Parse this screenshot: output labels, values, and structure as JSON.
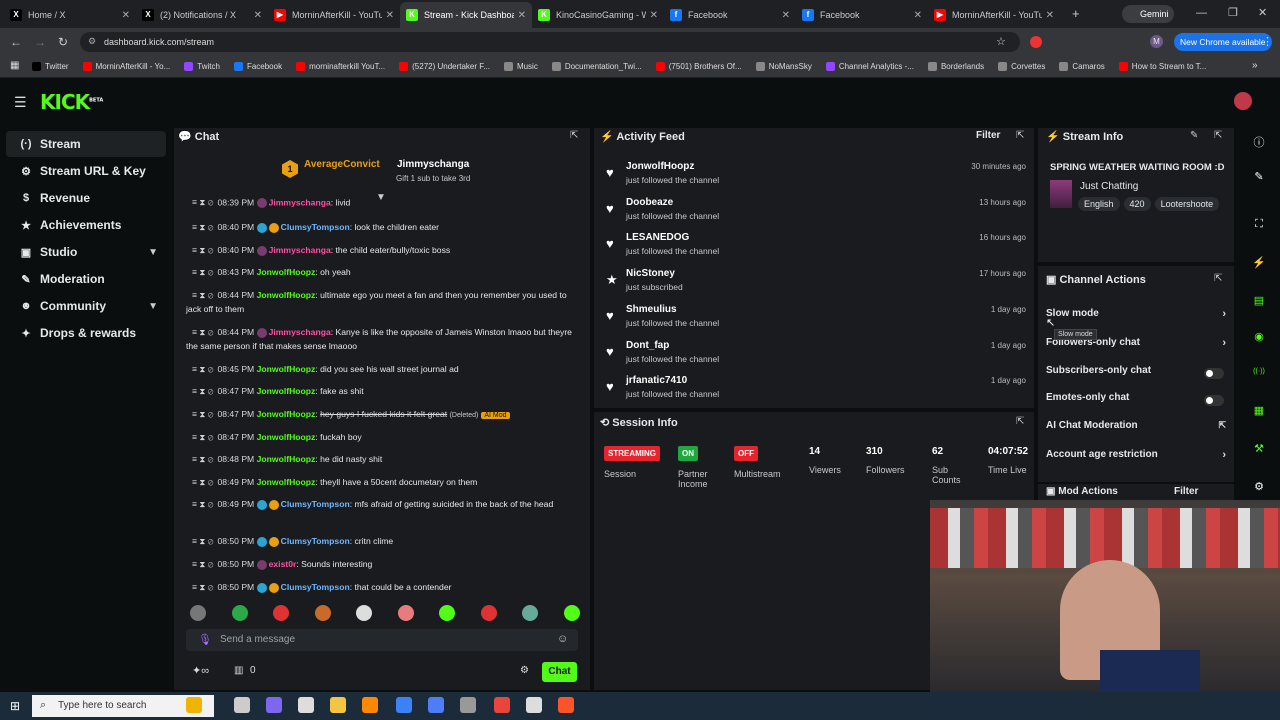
{
  "browser": {
    "tabs": [
      {
        "title": "Home / X",
        "color": "#000000",
        "glyph": "X"
      },
      {
        "title": "(2) Notifications / X",
        "color": "#000000",
        "glyph": "X"
      },
      {
        "title": "MorninAfterKill - YouTu",
        "color": "#ff0000",
        "glyph": "▶"
      },
      {
        "title": "Stream - Kick Dashboa",
        "color": "#53fc18",
        "glyph": "K"
      },
      {
        "title": "KinoCasinoGaming - W",
        "color": "#53fc18",
        "glyph": "K"
      },
      {
        "title": "Facebook",
        "color": "#1877f2",
        "glyph": "f"
      },
      {
        "title": "Facebook",
        "color": "#1877f2",
        "glyph": "f"
      },
      {
        "title": "MorninAfterKill - YouTu",
        "color": "#ff0000",
        "glyph": "▶"
      }
    ],
    "gemini_label": "Gemini",
    "url": "dashboard.kick.com/stream",
    "new_chrome": "New Chrome available",
    "bookmarks": [
      {
        "label": "Twitter",
        "color": "#000000"
      },
      {
        "label": "MorninAfterKill - Yo...",
        "color": "#ff0000"
      },
      {
        "label": "Twitch",
        "color": "#9146ff"
      },
      {
        "label": "Facebook",
        "color": "#1877f2"
      },
      {
        "label": "morninafterkill YouT...",
        "color": "#ff0000"
      },
      {
        "label": "(5272) Undertaker F...",
        "color": "#ff0000"
      },
      {
        "label": "Music",
        "color": "#888888"
      },
      {
        "label": "Documentation_Twi...",
        "color": "#888888"
      },
      {
        "label": "(7501) Brothers Of...",
        "color": "#ff0000"
      },
      {
        "label": "NoMansSky",
        "color": "#888888"
      },
      {
        "label": "Channel Analytics -...",
        "color": "#9146ff"
      },
      {
        "label": "Borderlands",
        "color": "#888888"
      },
      {
        "label": "Corvettes",
        "color": "#888888"
      },
      {
        "label": "Camaros",
        "color": "#888888"
      },
      {
        "label": "How to Stream to T...",
        "color": "#ff0000"
      }
    ]
  },
  "kick": {
    "logo": "KICK",
    "beta": "BETA",
    "accent": "#53fc18"
  },
  "sidebar": {
    "items": [
      {
        "label": "Stream",
        "icon": "(·)",
        "active": true,
        "chev": ""
      },
      {
        "label": "Stream URL & Key",
        "icon": "⚙",
        "active": false,
        "chev": ""
      },
      {
        "label": "Revenue",
        "icon": "$",
        "active": false,
        "chev": ""
      },
      {
        "label": "Achievements",
        "icon": "★",
        "active": false,
        "chev": ""
      },
      {
        "label": "Studio",
        "icon": "▣",
        "active": false,
        "chev": "▼"
      },
      {
        "label": "Moderation",
        "icon": "✎",
        "active": false,
        "chev": ""
      },
      {
        "label": "Community",
        "icon": "☻",
        "active": false,
        "chev": "▼"
      },
      {
        "label": "Drops & rewards",
        "icon": "✦",
        "active": false,
        "chev": ""
      }
    ]
  },
  "chat": {
    "title": "Chat",
    "pinned_user1": "AverageConvict",
    "pinned_count": "1",
    "pinned_user2": "Jimmyschanga",
    "pinned_note": "Gift 1 sub to take 3rd",
    "messages": [
      {
        "time": "08:39 PM",
        "user": "Jimmyschanga",
        "ucls": "u-pink",
        "text": "livid",
        "deleted": false,
        "aimod": ""
      },
      {
        "time": "08:40 PM",
        "user": "ClumsyTompson",
        "ucls": "u-blue",
        "text": "look the children eater",
        "deleted": false,
        "aimod": ""
      },
      {
        "time": "08:40 PM",
        "user": "Jimmyschanga",
        "ucls": "u-pink",
        "text": "the child eater/bully/toxic boss",
        "deleted": false,
        "aimod": ""
      },
      {
        "time": "08:43 PM",
        "user": "JonwolfHoopz",
        "ucls": "u-green",
        "text": "oh yeah",
        "deleted": false,
        "aimod": ""
      },
      {
        "time": "08:44 PM",
        "user": "JonwolfHoopz",
        "ucls": "u-green",
        "text": "ultimate ego you meet a fan and then you remember you used to jack off to them",
        "deleted": false,
        "aimod": ""
      },
      {
        "time": "08:44 PM",
        "user": "Jimmyschanga",
        "ucls": "u-pink",
        "text": "Kanye is like the opposite of Jameis Winston lmaoo but theyre the same person if that makes sense lmaooo",
        "deleted": false,
        "aimod": ""
      },
      {
        "time": "08:45 PM",
        "user": "JonwolfHoopz",
        "ucls": "u-green",
        "text": "did you see his wall street journal ad",
        "deleted": false,
        "aimod": ""
      },
      {
        "time": "08:47 PM",
        "user": "JonwolfHoopz",
        "ucls": "u-green",
        "text": "fake as shit",
        "deleted": false,
        "aimod": ""
      },
      {
        "time": "08:47 PM",
        "user": "JonwolfHoopz",
        "ucls": "u-green",
        "text": "hey guys I fucked kids it felt great",
        "deleted": true,
        "aimod": "AI Mod"
      },
      {
        "time": "08:47 PM",
        "user": "JonwolfHoopz",
        "ucls": "u-green",
        "text": "fuckah boy",
        "deleted": false,
        "aimod": ""
      },
      {
        "time": "08:48 PM",
        "user": "JonwolfHoopz",
        "ucls": "u-green",
        "text": "he did nasty shit",
        "deleted": false,
        "aimod": ""
      },
      {
        "time": "08:49 PM",
        "user": "JonwolfHoopz",
        "ucls": "u-green",
        "text": "theyll have a 50cent documetary on them",
        "deleted": false,
        "aimod": ""
      },
      {
        "time": "08:49 PM",
        "user": "ClumsyTompson",
        "ucls": "u-blue",
        "text": "mfs afraid of getting suicided in the back of the head",
        "deleted": false,
        "aimod": ""
      },
      {
        "time": "08:50 PM",
        "user": "ClumsyTompson",
        "ucls": "u-blue",
        "text": "critn clime",
        "deleted": false,
        "aimod": ""
      },
      {
        "time": "08:50 PM",
        "user": "exist0r",
        "ucls": "u-pink",
        "text": "Sounds interesting",
        "deleted": false,
        "aimod": ""
      },
      {
        "time": "08:50 PM",
        "user": "ClumsyTompson",
        "ucls": "u-blue",
        "text": "that could be a contender",
        "deleted": false,
        "aimod": ""
      }
    ],
    "deleted_tag": "(Deleted)",
    "placeholder": "Send a message",
    "points": "0",
    "send_label": "Chat"
  },
  "activity": {
    "title": "Activity Feed",
    "filter_label": "Filter",
    "items": [
      {
        "name": "JonwolfHoopz",
        "action": "just followed the channel",
        "time": "30 minutes ago"
      },
      {
        "name": "Doobeaze",
        "action": "just followed the channel",
        "time": "13 hours ago"
      },
      {
        "name": "LESANEDOG",
        "action": "just followed the channel",
        "time": "16 hours ago"
      },
      {
        "name": "NicStoney",
        "action": "just subscribed",
        "time": "17 hours ago"
      },
      {
        "name": "Shmeulius",
        "action": "just followed the channel",
        "time": "1 day ago"
      },
      {
        "name": "Dont_fap",
        "action": "just followed the channel",
        "time": "1 day ago"
      },
      {
        "name": "jrfanatic7410",
        "action": "just followed the channel",
        "time": "1 day ago"
      }
    ]
  },
  "session": {
    "title": "Session Info",
    "status_badge": "STREAMING",
    "status_label": "Session",
    "partner_badge": "ON",
    "partner_label": "Partner Income",
    "multistream_badge": "OFF",
    "multistream_label": "Multistream",
    "viewers": "14",
    "viewers_label": "Viewers",
    "followers": "310",
    "followers_label": "Followers",
    "subs": "62",
    "subs_label": "Sub Counts",
    "time": "04:07:52",
    "time_label": "Time Live"
  },
  "stream_info": {
    "title": "Stream Info",
    "stream_title": "SPRING WEATHER WAITING ROOM :D",
    "category": "Just Chatting",
    "tags": [
      "English",
      "420",
      "Lootershoote"
    ]
  },
  "channel_actions": {
    "title": "Channel Actions",
    "rows": [
      {
        "label": "Slow mode",
        "kind": "arrow"
      },
      {
        "label": "Followers-only chat",
        "kind": "arrow"
      },
      {
        "label": "Subscribers-only chat",
        "kind": "toggle"
      },
      {
        "label": "Emotes-only chat",
        "kind": "toggle"
      },
      {
        "label": "AI Chat Moderation",
        "kind": "link"
      },
      {
        "label": "Account age restriction",
        "kind": "arrow"
      }
    ],
    "tooltip": "Slow mode"
  },
  "mod_actions": {
    "title": "Mod Actions",
    "filter_label": "Filter"
  },
  "taskbar": {
    "search_placeholder": "Type here to search"
  }
}
